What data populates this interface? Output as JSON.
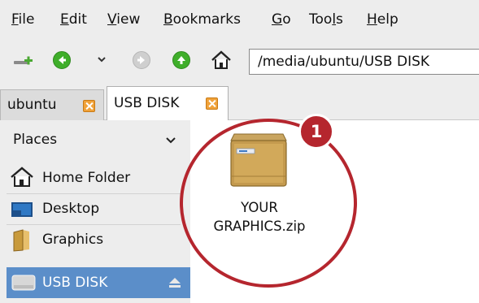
{
  "menubar": {
    "items": [
      {
        "underline": "F",
        "rest": "ile"
      },
      {
        "underline": "E",
        "rest": "dit"
      },
      {
        "underline": "V",
        "rest": "iew"
      },
      {
        "underline": "B",
        "rest": "ookmarks"
      },
      {
        "underline": "G",
        "rest": "o"
      },
      {
        "pre": "Too",
        "underline": "l",
        "rest": "s"
      },
      {
        "underline": "H",
        "rest": "elp"
      }
    ]
  },
  "toolbar": {
    "address": "/media/ubuntu/USB DISK",
    "icons": [
      "new-tab-icon",
      "back-icon",
      "history-dropdown-icon",
      "forward-icon",
      "up-icon",
      "home-icon"
    ]
  },
  "tabs": [
    {
      "label": "ubuntu",
      "active": false
    },
    {
      "label": "USB DISK",
      "active": true
    }
  ],
  "sidebar": {
    "header": "Places",
    "items": [
      {
        "label": "Home Folder",
        "icon": "home-icon"
      },
      {
        "label": "Desktop",
        "icon": "desktop-icon"
      },
      {
        "label": "Graphics",
        "icon": "folder-icon"
      }
    ],
    "device": {
      "label": "USB DISK",
      "icon": "drive-icon",
      "eject": "eject-icon"
    }
  },
  "content": {
    "file_line1": "YOUR",
    "file_line2": "GRAPHICS.zip",
    "file_icon": "archive-icon"
  },
  "annotation": {
    "badge": "1",
    "color": "#b5262e"
  },
  "colors": {
    "selection": "#5b8ec9",
    "tab_close": "#f0a23a",
    "nav_green": "#3fae2a"
  }
}
